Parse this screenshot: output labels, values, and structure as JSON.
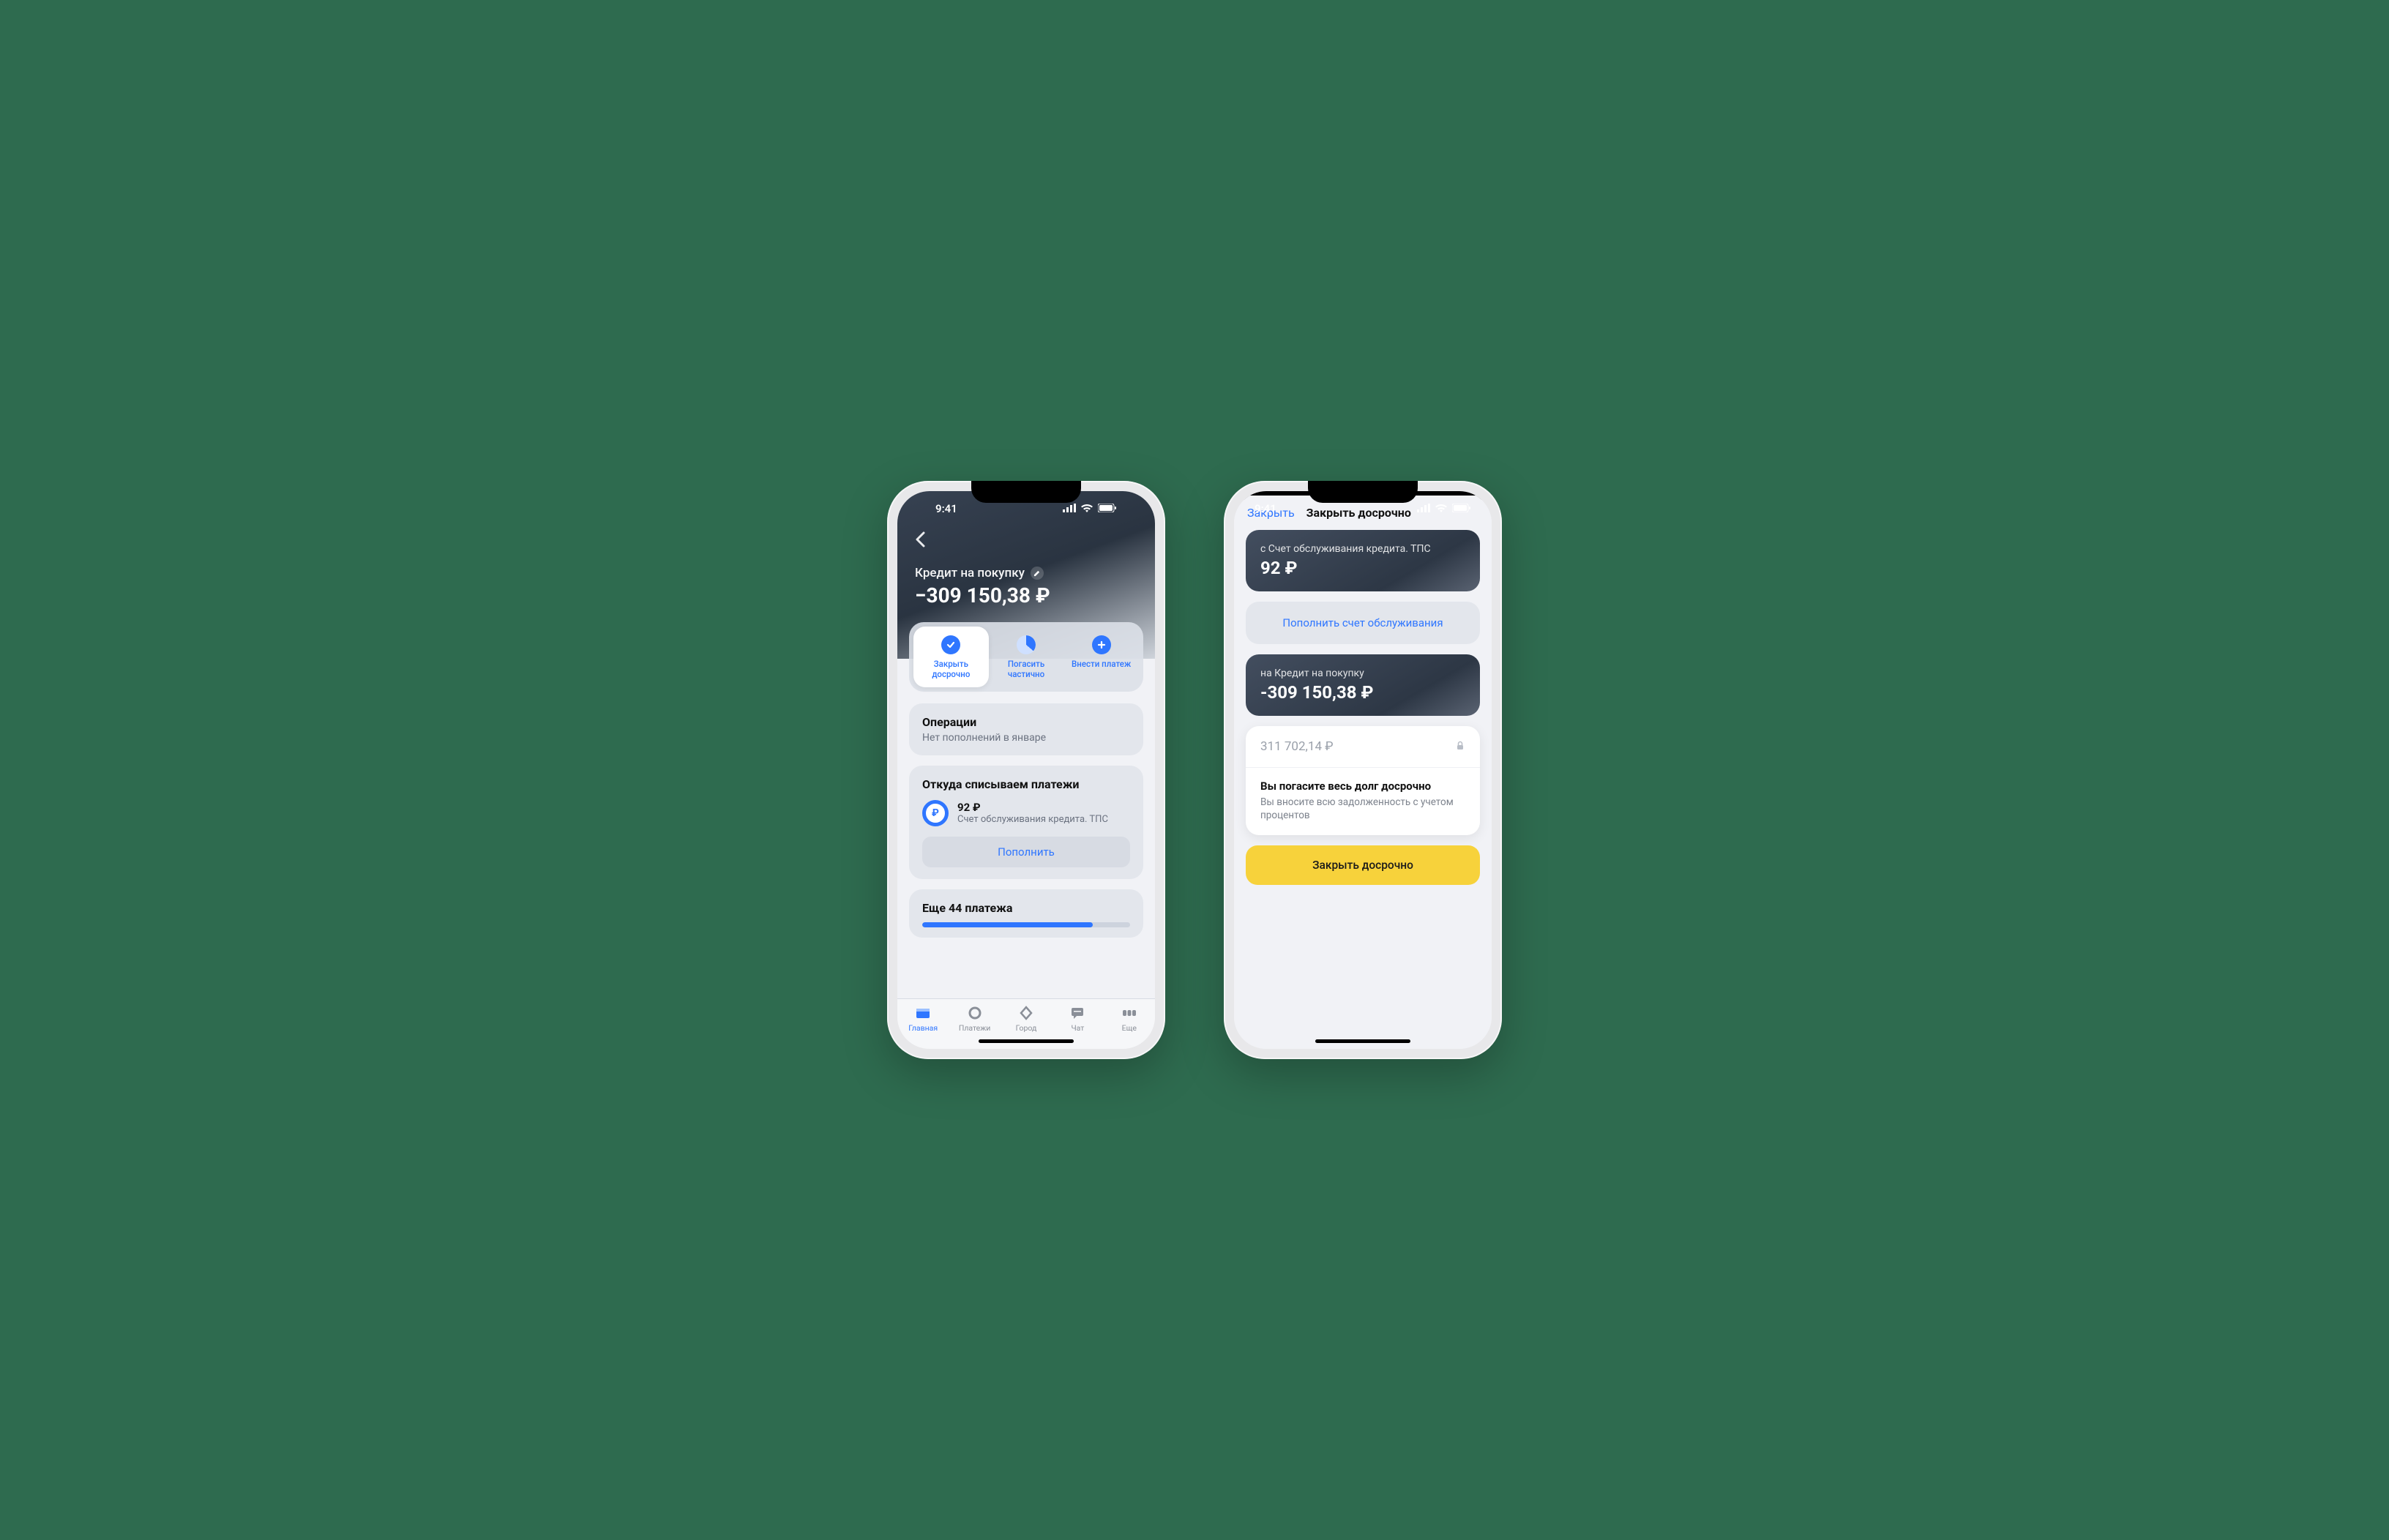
{
  "status": {
    "time": "9:41"
  },
  "phone1": {
    "loan_title": "Кредит на покупку",
    "loan_balance": "−309 150,38 ₽",
    "actions": {
      "close_early": "Закрыть досрочно",
      "pay_partial": "Погасить частично",
      "make_payment": "Внести платеж"
    },
    "operations": {
      "title": "Операции",
      "subtitle": "Нет пополнений в январе"
    },
    "source": {
      "title": "Откуда списываем платежи",
      "amount": "92 ₽",
      "account": "Счет обслуживания кредита. ТПС",
      "topup": "Пополнить"
    },
    "remaining": "Еще 44 платежа",
    "tabs": {
      "home": "Главная",
      "payments": "Платежи",
      "city": "Город",
      "chat": "Чат",
      "more": "Еще"
    }
  },
  "phone2": {
    "close": "Закрыть",
    "title": "Закрыть досрочно",
    "from": {
      "label": "с Счет обслуживания кредита. ТПС",
      "amount": "92 ₽"
    },
    "topup_link": "Пополнить счет обслуживания",
    "to": {
      "label": "на Кредит на покупку",
      "amount": "-309 150,38 ₽"
    },
    "total_amount": "311 702,14 ₽",
    "info_title": "Вы погасите весь долг досрочно",
    "info_sub": "Вы вносите всю задолженность с учетом процентов",
    "cta": "Закрыть досрочно"
  }
}
